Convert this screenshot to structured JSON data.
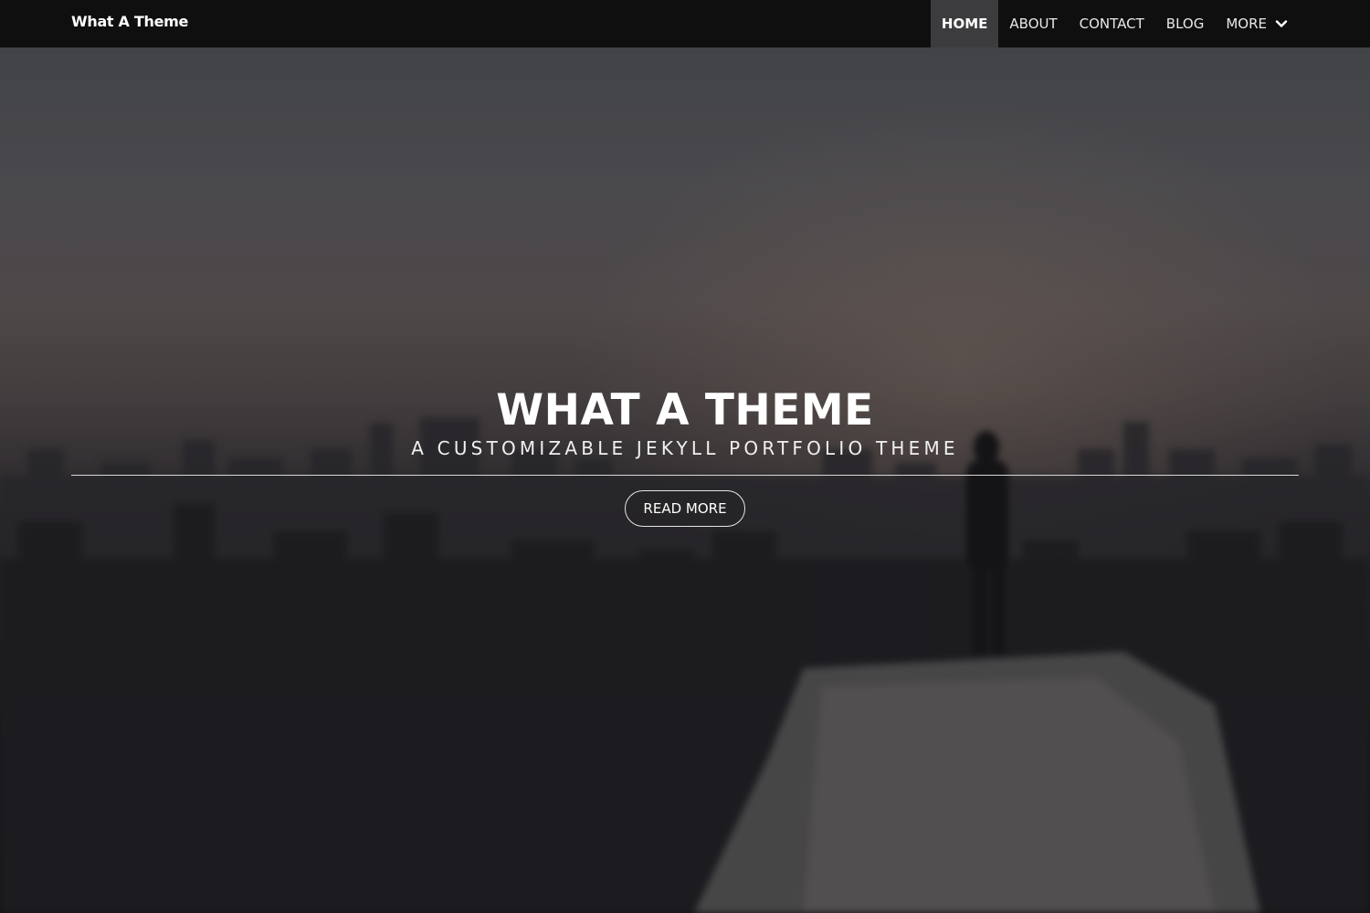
{
  "navbar": {
    "brand": "What A Theme",
    "items": [
      {
        "label": "HOME",
        "active": true
      },
      {
        "label": "ABOUT",
        "active": false
      },
      {
        "label": "CONTACT",
        "active": false
      },
      {
        "label": "BLOG",
        "active": false
      },
      {
        "label": "MORE",
        "active": false,
        "icon": "chevron-down-icon"
      }
    ]
  },
  "hero": {
    "title": "WHAT A THEME",
    "subtitle": "A CUSTOMIZABLE JEKYLL PORTFOLIO THEME",
    "button_label": "READ MORE",
    "background": "blurred city skyline with a person standing on a rooftop ledge"
  },
  "colors": {
    "navbar_bg": "#0f0f0f",
    "nav_active_bg": "#3c3c3e",
    "text": "#ffffff"
  }
}
